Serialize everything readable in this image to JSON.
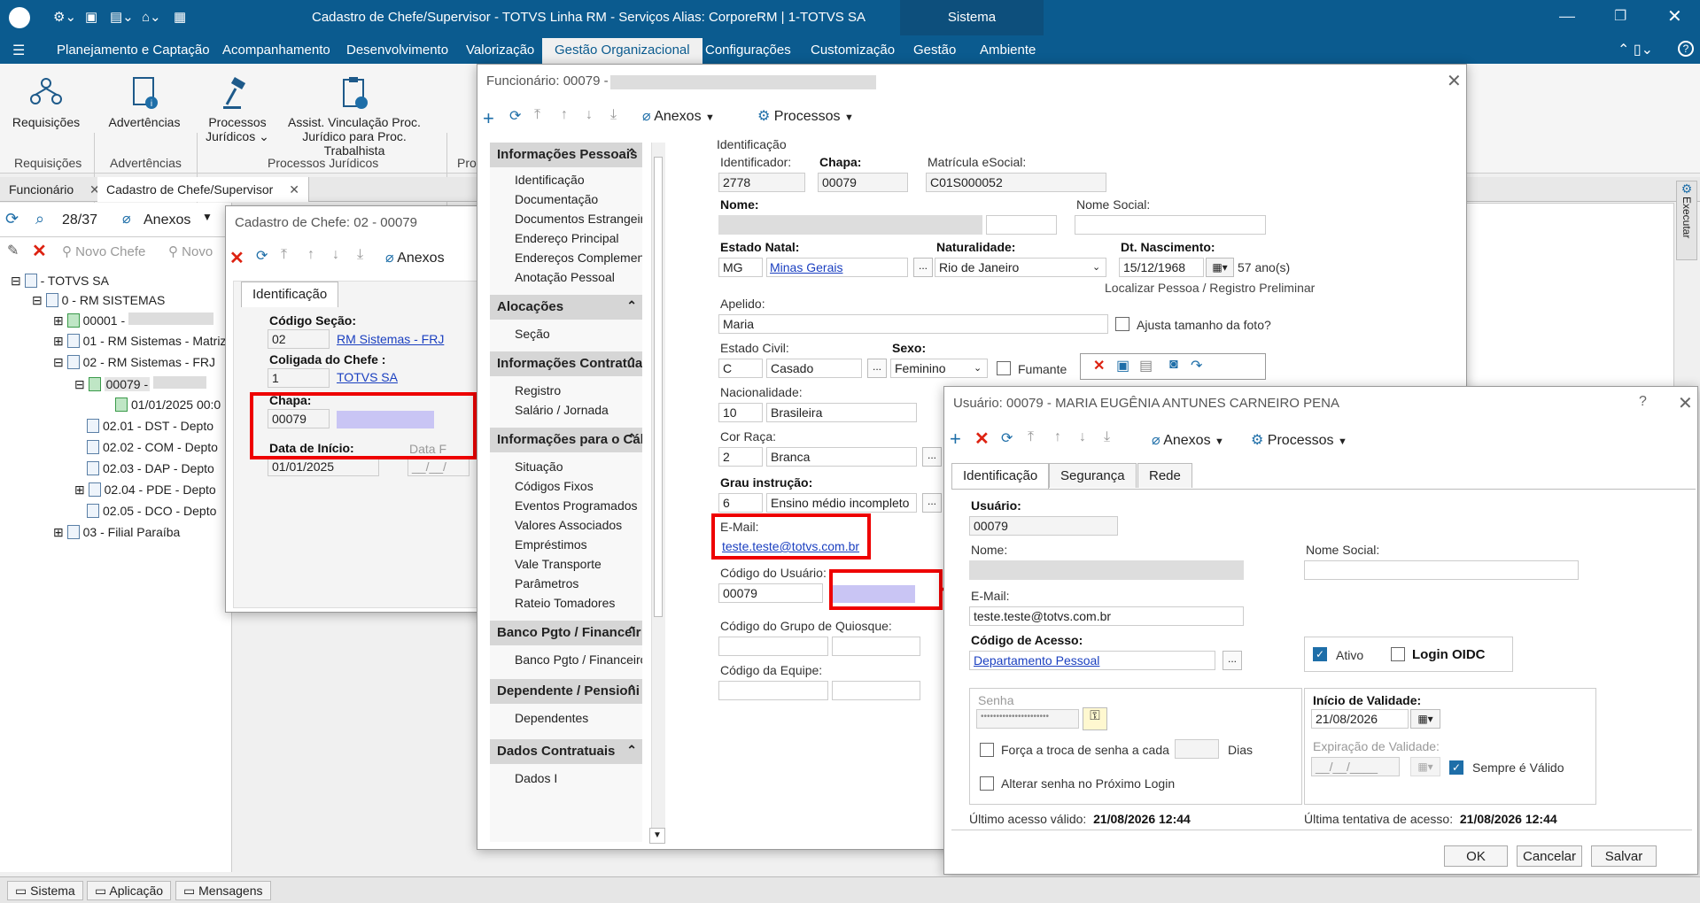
{
  "app": {
    "title": "Cadastro de Chefe/Supervisor - TOTVS Linha RM - Serviços  Alias: CorporeRM | 1-TOTVS SA",
    "sistema_tab": "Sistema"
  },
  "menu": [
    "Planejamento e Captação",
    "Acompanhamento",
    "Desenvolvimento",
    "Valorização",
    "Gestão Organizacional",
    "Configurações",
    "Customização",
    "Gestão",
    "Ambiente"
  ],
  "ribbon": {
    "buttons": [
      {
        "label": "Requisições",
        "sub": "⌄"
      },
      {
        "label": "Advertências",
        "sub": "⌄"
      },
      {
        "label": "Processos\nJurídicos ⌄",
        "sub": ""
      },
      {
        "label": "Assist. Vinculação Proc.\nJurídico para Proc. Trabalhista",
        "sub": ""
      }
    ],
    "groups": [
      "Requisições",
      "Advertências",
      "Processos Jurídicos",
      "Pro"
    ]
  },
  "doc_tabs": [
    "Funcionário",
    "Cadastro de Chefe/Supervisor"
  ],
  "left_toolbar": {
    "counter": "28/37",
    "anexos": "Anexos",
    "novo_chefe": "Novo Chefe",
    "novo": "Novo"
  },
  "tree": [
    {
      "label": "- TOTVS SA"
    },
    {
      "label": "0 - RM SISTEMAS"
    },
    {
      "label": "00001 -"
    },
    {
      "label": "01 - RM Sistemas - Matriz"
    },
    {
      "label": "02 - RM Sistemas - FRJ"
    },
    {
      "label": "00079 -"
    },
    {
      "label": "01/01/2025 00:0"
    },
    {
      "label": "02.01 - DST - Depto"
    },
    {
      "label": "02.02 - COM - Depto"
    },
    {
      "label": "02.03 - DAP - Depto"
    },
    {
      "label": "02.04 - PDE - Depto"
    },
    {
      "label": "02.05 - DCO - Depto"
    },
    {
      "label": "03 - Filial Paraíba"
    }
  ],
  "chefe": {
    "title": "Cadastro de Chefe: 02 - 00079",
    "anexos": "Anexos",
    "tab": "Identificação",
    "codigo_secao_lbl": "Código Seção:",
    "codigo_secao": "02",
    "secao_link": "RM Sistemas - FRJ",
    "coligada_lbl": "Coligada do Chefe :",
    "coligada": "1",
    "coligada_link": "TOTVS SA",
    "chapa_lbl": "Chapa:",
    "chapa": "00079",
    "data_inicio_lbl": "Data de Início:",
    "data_inicio": "01/01/2025",
    "data_fim_lbl": "Data F",
    "data_fim": "__/__/"
  },
  "func": {
    "title": "Funcionário: 00079 -",
    "anexos": "Anexos",
    "processos": "Processos",
    "sections": [
      {
        "title": "Informações Pessoais",
        "items": [
          "Identificação",
          "Documentação",
          "Documentos Estrangeiros",
          "Endereço Principal",
          "Endereços Complementa...",
          "Anotação Pessoal"
        ]
      },
      {
        "title": "Alocações",
        "items": [
          "Seção"
        ]
      },
      {
        "title": "Informações Contratuai",
        "items": [
          "Registro",
          "Salário / Jornada"
        ]
      },
      {
        "title": "Informações para o Cál",
        "items": [
          "Situação",
          "Códigos Fixos",
          "Eventos Programados",
          "Valores Associados",
          "Empréstimos",
          "Vale Transporte",
          "Parâmetros",
          "Rateio Tomadores"
        ]
      },
      {
        "title": "Banco Pgto / Financeir",
        "items": [
          "Banco Pgto / Financeiro"
        ]
      },
      {
        "title": "Dependente / Pensioni",
        "items": [
          "Dependentes"
        ]
      },
      {
        "title": "Dados Contratuais",
        "items": [
          "Dados I"
        ]
      }
    ],
    "ident_header": "Identificação",
    "identificador_lbl": "Identificador:",
    "identificador": "2778",
    "chapa_lbl": "Chapa:",
    "chapa": "00079",
    "matricula_lbl": "Matrícula eSocial:",
    "matricula": "C01S000052",
    "nome_lbl": "Nome:",
    "nome_social_lbl": "Nome Social:",
    "estado_natal_lbl": "Estado Natal:",
    "estado_natal": "MG",
    "estado_natal_link": "Minas Gerais",
    "naturalidade_lbl": "Naturalidade:",
    "naturalidade": "Rio de Janeiro",
    "dt_nasc_lbl": "Dt. Nascimento:",
    "dt_nasc": "15/12/1968",
    "idade": "57 ano(s)",
    "localizar": "Localizar Pessoa / Registro Preliminar",
    "apelido_lbl": "Apelido:",
    "apelido": "Maria",
    "ajusta_foto": "Ajusta tamanho da foto?",
    "estado_civil_lbl": "Estado Civil:",
    "estado_civil_cod": "C",
    "estado_civil": "Casado",
    "sexo_lbl": "Sexo:",
    "sexo": "Feminino",
    "fumante": "Fumante",
    "nacionalidade_lbl": "Nacionalidade:",
    "nacionalidade_cod": "10",
    "nacionalidade": "Brasileira",
    "cor_raca_lbl": "Cor Raça:",
    "cor_raca_cod": "2",
    "cor_raca": "Branca",
    "grau_lbl": "Grau instrução:",
    "grau_cod": "6",
    "grau": "Ensino médio incompleto",
    "email_lbl": "E-Mail:",
    "email": "teste.teste@totvs.com.br",
    "codigo_usuario_lbl": "Código do Usuário:",
    "codigo_usuario": "00079",
    "grupo_quiosque_lbl": "Código do Grupo de Quiosque:",
    "equipe_lbl": "Código da Equipe:"
  },
  "usuario": {
    "title": "Usuário: 00079 - MARIA EUGÊNIA ANTUNES CARNEIRO PENA",
    "help": "?",
    "anexos": "Anexos",
    "processos": "Processos",
    "tabs": [
      "Identificação",
      "Segurança",
      "Rede"
    ],
    "usuario_lbl": "Usuário:",
    "usuario": "00079",
    "nome_lbl": "Nome:",
    "nome_social_lbl": "Nome Social:",
    "email_lbl": "E-Mail:",
    "email": "teste.teste@totvs.com.br",
    "codigo_acesso_lbl": "Código de Acesso:",
    "codigo_acesso": "Departamento Pessoal",
    "ativo": "Ativo",
    "login_oidc": "Login OIDC",
    "senha_lbl": "Senha",
    "senha": "••••••••••••••••••••••",
    "forca_troca": "Força a troca de senha a cada",
    "dias": "Dias",
    "alterar_senha": "Alterar senha no Próximo Login",
    "inicio_validade_lbl": "Início de Validade:",
    "inicio_validade": "21/08/2026",
    "expiracao_lbl": "Expiração de Validade:",
    "expiracao": "__/__/____",
    "sempre_valido": "Sempre é Válido",
    "ultimo_acesso_lbl": "Último acesso válido:",
    "ultimo_acesso": "21/08/2026 12:44",
    "ultima_tentativa_lbl": "Última tentativa de acesso:",
    "ultima_tentativa": "21/08/2026 12:44",
    "ok": "OK",
    "cancelar": "Cancelar",
    "salvar": "Salvar"
  },
  "status": [
    "Sistema",
    "Aplicação",
    "Mensagens"
  ],
  "side_executar": "Executar",
  "colors": {
    "brand": "#0b5b8f",
    "highlight": "#e00000",
    "link": "#1a3fc0",
    "check": "#1e6ea8"
  }
}
